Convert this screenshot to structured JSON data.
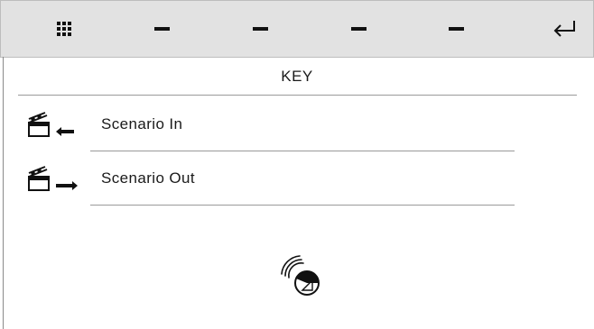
{
  "toolbar": {
    "buttons": [
      {
        "icon": "grid-icon"
      },
      {
        "icon": "dash-icon"
      },
      {
        "icon": "dash-icon"
      },
      {
        "icon": "dash-icon"
      },
      {
        "icon": "dash-icon"
      },
      {
        "icon": "enter-return-icon"
      }
    ]
  },
  "key": {
    "title": "KEY",
    "items": [
      {
        "label": "Scenario In",
        "icon": "clapperboard-arrow-in-icon"
      },
      {
        "label": "Scenario Out",
        "icon": "clapperboard-arrow-out-icon"
      }
    ]
  },
  "status": {
    "icon": "loading-spinner-icon"
  },
  "colors": {
    "toolbar_bg": "#e2e2e2",
    "text": "#1a1a1a",
    "rule": "#9a9a9a"
  }
}
